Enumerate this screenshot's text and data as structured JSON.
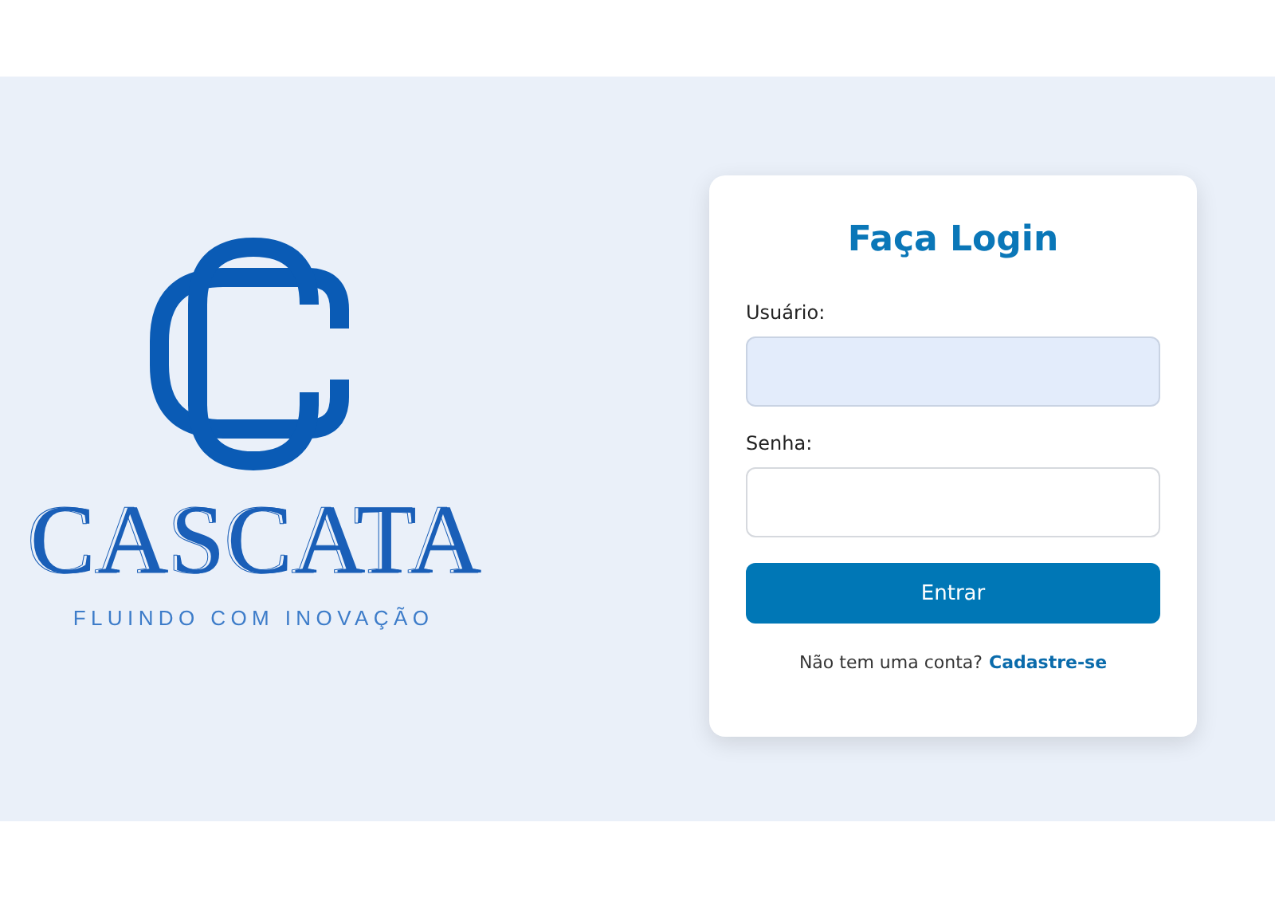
{
  "brand": {
    "name": "CASCATA",
    "tagline": "FLUINDO COM INOVAÇÃO"
  },
  "login": {
    "title": "Faça Login",
    "fields": [
      {
        "label": "Usuário:",
        "autofilled": true
      },
      {
        "label": "Senha:",
        "autofilled": false
      }
    ],
    "submit": "Entrar",
    "signup": {
      "prompt": "Não tem uma conta?",
      "link": "Cadastre-se"
    }
  }
}
